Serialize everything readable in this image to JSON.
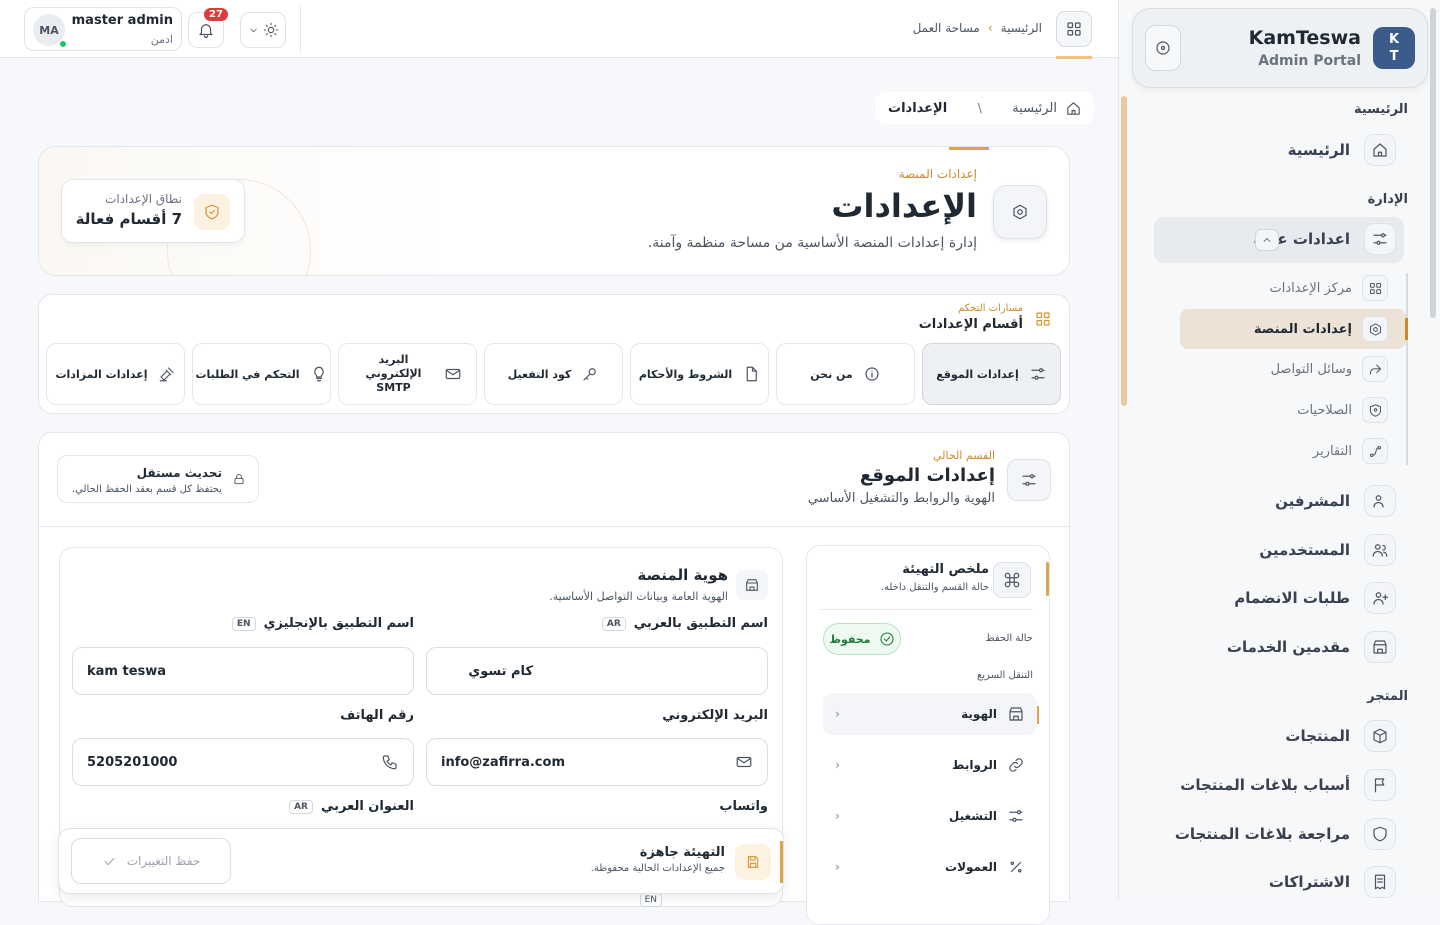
{
  "sidebar": {
    "brand_logo_line1": "K",
    "brand_logo_line2": "T",
    "brand_name": "KamTeswa",
    "brand_sub": "Admin Portal",
    "section_home": "الرئيسية",
    "home_item": "الرئيسية",
    "section_admin": "الإدارة",
    "general_settings": "اعدادات عامة",
    "sub_items": [
      "مركز الإعدادات",
      "إعدادات المنصة",
      "وسائل التواصل",
      "الصلاحيات",
      "التقارير"
    ],
    "admin_items": [
      "المشرفين",
      "المستخدمين",
      "طلبات الانضمام",
      "مقدمين الخدمات"
    ],
    "section_store": "المتجر",
    "store_items": [
      "المنتجات",
      "أسباب بلاغات المنتجات",
      "مراجعة بلاغات المنتجات",
      "الاشتراكات"
    ]
  },
  "topbar": {
    "user_initials": "MA",
    "user_name": "master admin",
    "user_role": "ادمن",
    "notif_count": "27",
    "crumb_home": "الرئيسية",
    "crumb_sep": "›",
    "crumb_workspace": "مساحة العمل"
  },
  "breadcrumb": {
    "home": "الرئيسية",
    "sep": "\\",
    "current": "الإعدادات"
  },
  "hero": {
    "kicker": "إعدادات المنصة",
    "title": "الإعدادات",
    "desc": "إدارة إعدادات المنصة الأساسية من مساحة منظمة وآمنة.",
    "scope_label": "نطاق الإعدادات",
    "scope_value": "7 أقسام فعالة"
  },
  "tabs": {
    "kicker": "مسارات التحكم",
    "title": "أقسام الإعدادات",
    "items": [
      "إعدادات الموقع",
      "من نحن",
      "الشروط والأحكام",
      "كود التفعيل",
      "البريد الإلكتروني SMTP",
      "التحكم في الطلبات",
      "إعدادات المزادات"
    ]
  },
  "current": {
    "kicker": "القسم الحالي",
    "title": "إعدادات الموقع",
    "desc": "الهوية والروابط والتشغيل الأساسي",
    "indep_title": "تحديث مستقل",
    "indep_desc": "يحتفظ كل قسم بعقد الحفظ الحالي."
  },
  "summary": {
    "title": "ملخص التهيئة",
    "desc": "حالة القسم والتنقل داخله.",
    "save_state_label": "حالة الحفظ",
    "save_state_value": "محفوظ",
    "quick_nav_label": "التنقل السريع",
    "quick_items": [
      "الهوية",
      "الروابط",
      "التشغيل",
      "العمولات"
    ]
  },
  "identity": {
    "title": "هوية المنصة",
    "desc": "الهوية العامة وبيانات التواصل الأساسية.",
    "name_ar_label": "اسم التطبيق بالعربي",
    "name_ar_tag": "AR",
    "name_ar_value": "كام تسوي",
    "name_en_label": "اسم التطبيق بالإنجليزي",
    "name_en_tag": "EN",
    "name_en_value": "kam teswa",
    "email_label": "البريد الإلكتروني",
    "email_value": "info@zafirra.com",
    "phone_label": "رقم الهاتف",
    "phone_value": "5205201000",
    "whatsapp_label": "واتساب",
    "address_ar_label": "العنوان العربي",
    "address_ar_tag": "AR",
    "address_en_tag": "EN"
  },
  "savebar": {
    "title": "التهيئة جاهزة",
    "desc": "جميع الإعدادات الحالية محفوظة.",
    "button": "حفظ التغييرات"
  }
}
